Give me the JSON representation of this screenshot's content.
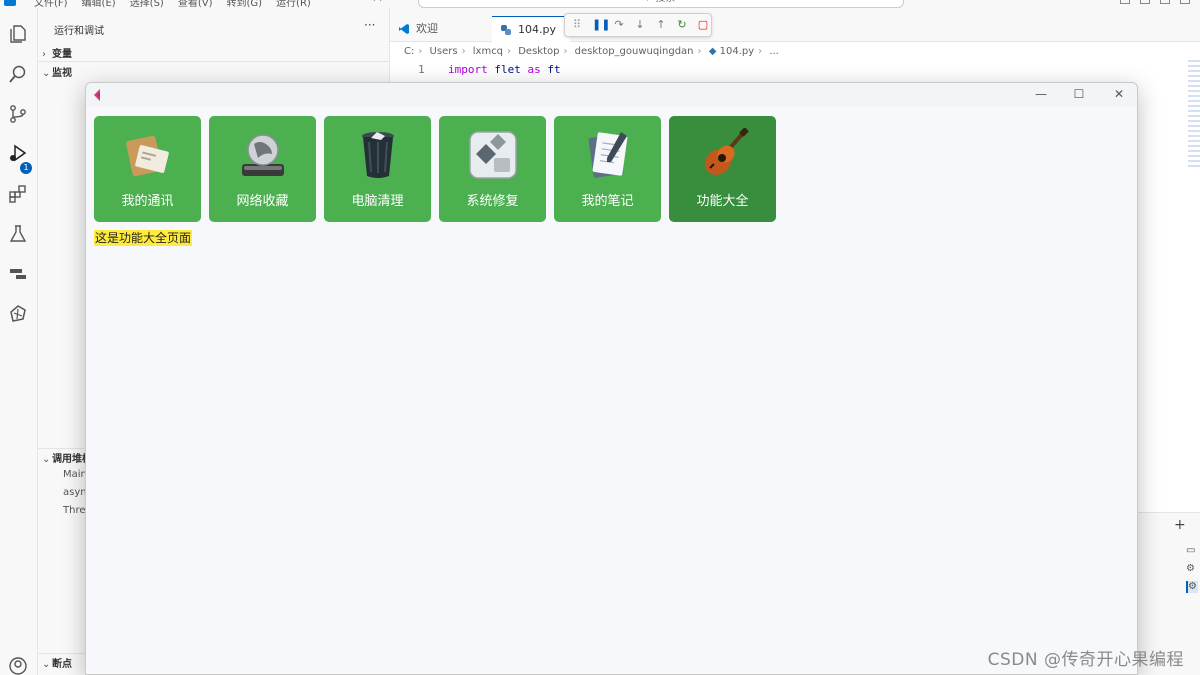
{
  "vscode": {
    "menu": [
      "文件(F)",
      "编辑(E)",
      "选择(S)",
      "查看(V)",
      "转到(G)",
      "运行(R)"
    ],
    "search_placeholder": "搜索",
    "activity_badge": "1",
    "sidebar": {
      "title": "运行和调试",
      "more": "···",
      "sections": {
        "variables": "变量",
        "watch": "监视",
        "callstack": "调用堆栈",
        "breakpoints": "断点"
      },
      "callstack_items": [
        "Main",
        "asyn",
        "Thre"
      ]
    },
    "tabs": [
      {
        "label": "欢迎"
      },
      {
        "label": "104.py"
      }
    ],
    "breadcrumb": [
      "C:",
      "Users",
      "lxmcq",
      "Desktop",
      "desktop_gouwuqingdan",
      "104.py",
      "..."
    ],
    "code": {
      "line_number": "1",
      "keyword": "import",
      "module": "flet",
      "as_kw": "as",
      "alias": "ft"
    },
    "panel_plus": "+"
  },
  "app": {
    "tiles": [
      {
        "label": "我的通讯",
        "icon": "address-book-icon",
        "selected": false
      },
      {
        "label": "网络收藏",
        "icon": "network-drive-icon",
        "selected": false
      },
      {
        "label": "电脑清理",
        "icon": "trash-bin-icon",
        "selected": false
      },
      {
        "label": "系统修复",
        "icon": "system-repair-icon",
        "selected": false
      },
      {
        "label": "我的笔记",
        "icon": "notebook-icon",
        "selected": false
      },
      {
        "label": "功能大全",
        "icon": "guitar-icon",
        "selected": true
      }
    ],
    "page_text": "这是功能大全页面",
    "colors": {
      "tile": "#4caf50",
      "tile_selected": "#388e3c",
      "highlight": "#ffeb3b"
    }
  },
  "watermark": "CSDN @传奇开心果编程"
}
